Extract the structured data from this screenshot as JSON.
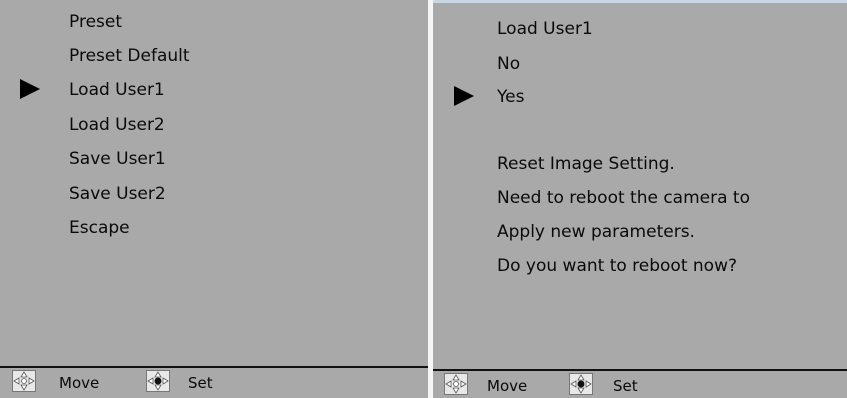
{
  "left_menu": {
    "items": [
      {
        "label": "Preset"
      },
      {
        "label": "Preset Default"
      },
      {
        "label": "Load User1",
        "selected": true
      },
      {
        "label": "Load User2"
      },
      {
        "label": "Save User1"
      },
      {
        "label": "Save User2"
      },
      {
        "label": "Escape"
      }
    ],
    "footer": {
      "move_label": "Move",
      "set_label": "Set"
    }
  },
  "right_menu": {
    "title": "Load User1",
    "options": [
      {
        "label": "No"
      },
      {
        "label": "Yes",
        "selected": true
      }
    ],
    "message_lines": [
      "Reset Image Setting.",
      "Need to reboot the camera to",
      "Apply new parameters.",
      "Do you want to reboot now?"
    ],
    "footer": {
      "move_label": "Move",
      "set_label": "Set"
    }
  },
  "colors": {
    "panel_background": "#a9a9a9",
    "text": "#0a0a0a",
    "pointer": "#000000"
  },
  "icons": {
    "selection_pointer": "pointer-icon",
    "move_hint": "dpad-move-icon",
    "set_hint": "dpad-set-icon"
  }
}
